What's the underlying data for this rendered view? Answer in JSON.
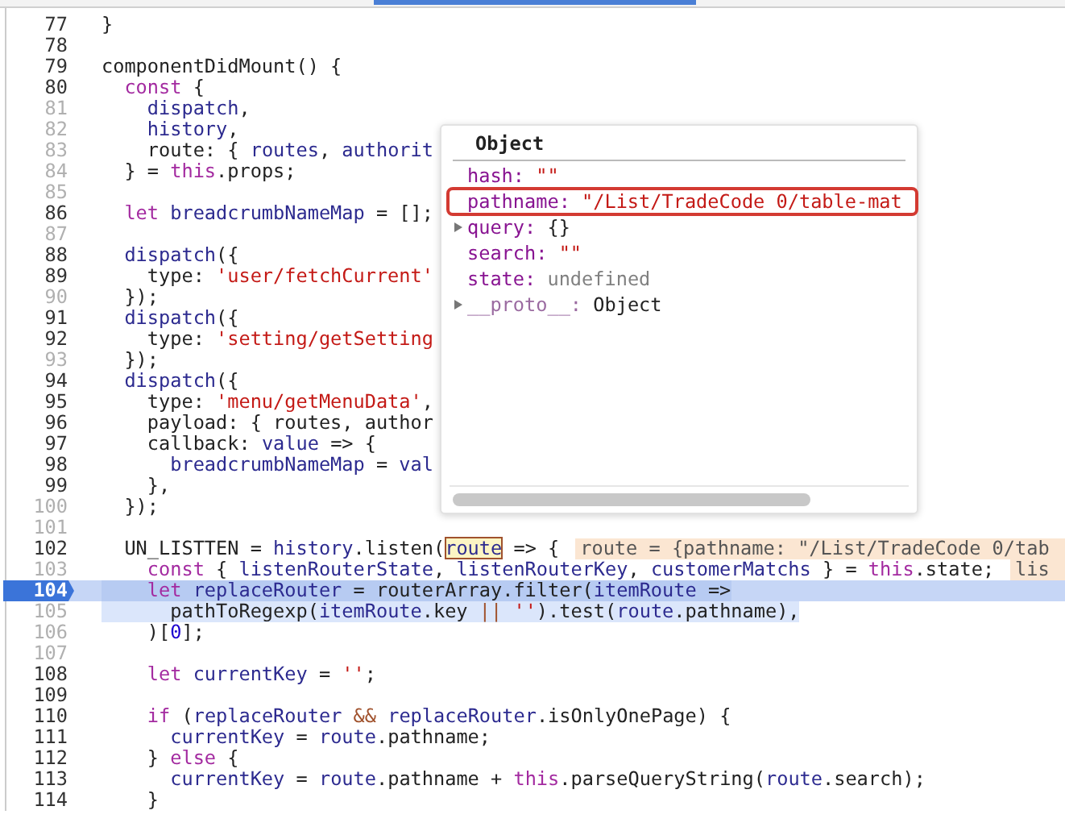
{
  "lines": [
    {
      "number": "77",
      "executable": true,
      "paused": false,
      "stepped": false,
      "tokens": [
        {
          "kind": "plain",
          "text": "}"
        }
      ]
    },
    {
      "number": "78",
      "executable": true,
      "paused": false,
      "stepped": false
    },
    {
      "number": "79",
      "executable": true,
      "paused": false,
      "stepped": false,
      "tokens": [
        {
          "kind": "plain",
          "text": "componentDidMount() {"
        }
      ]
    },
    {
      "number": "80",
      "executable": true,
      "paused": false,
      "stepped": false,
      "tokens": [
        {
          "kind": "kw",
          "text": "  const"
        },
        {
          "kind": "plain",
          "text": " {"
        }
      ]
    },
    {
      "number": "81",
      "executable": false,
      "paused": false,
      "stepped": false,
      "tokens": [
        {
          "kind": "var",
          "text": "    dispatch"
        },
        {
          "kind": "plain",
          "text": ","
        }
      ]
    },
    {
      "number": "82",
      "executable": false,
      "paused": false,
      "stepped": false,
      "tokens": [
        {
          "kind": "var",
          "text": "    history"
        },
        {
          "kind": "plain",
          "text": ","
        }
      ]
    },
    {
      "number": "83",
      "executable": false,
      "paused": false,
      "stepped": false,
      "tokens": [
        {
          "kind": "plain",
          "text": "    route: {"
        },
        {
          "kind": "var",
          "text": " routes"
        },
        {
          "kind": "plain",
          "text": ","
        },
        {
          "kind": "var",
          "text": " authorit"
        }
      ]
    },
    {
      "number": "84",
      "executable": false,
      "paused": false,
      "stepped": false,
      "tokens": [
        {
          "kind": "plain",
          "text": "  } ="
        },
        {
          "kind": "kw",
          "text": " this"
        },
        {
          "kind": "plain",
          "text": ".props;"
        }
      ]
    },
    {
      "number": "85",
      "executable": false,
      "paused": false,
      "stepped": false
    },
    {
      "number": "86",
      "executable": true,
      "paused": false,
      "stepped": false,
      "tokens": [
        {
          "kind": "kw",
          "text": "  let"
        },
        {
          "kind": "var",
          "text": " breadcrumbNameMap"
        },
        {
          "kind": "plain",
          "text": " = [];"
        }
      ]
    },
    {
      "number": "87",
      "executable": false,
      "paused": false,
      "stepped": false
    },
    {
      "number": "88",
      "executable": true,
      "paused": false,
      "stepped": false,
      "tokens": [
        {
          "kind": "var",
          "text": "  dispatch"
        },
        {
          "kind": "plain",
          "text": "({"
        }
      ]
    },
    {
      "number": "89",
      "executable": true,
      "paused": false,
      "stepped": false,
      "tokens": [
        {
          "kind": "plain",
          "text": "    type:"
        },
        {
          "kind": "str",
          "text": " 'user/fetchCurrent'"
        }
      ]
    },
    {
      "number": "90",
      "executable": false,
      "paused": false,
      "stepped": false,
      "tokens": [
        {
          "kind": "plain",
          "text": "  });"
        }
      ]
    },
    {
      "number": "91",
      "executable": true,
      "paused": false,
      "stepped": false,
      "tokens": [
        {
          "kind": "var",
          "text": "  dispatch"
        },
        {
          "kind": "plain",
          "text": "({"
        }
      ]
    },
    {
      "number": "92",
      "executable": true,
      "paused": false,
      "stepped": false,
      "tokens": [
        {
          "kind": "plain",
          "text": "    type:"
        },
        {
          "kind": "str",
          "text": " 'setting/getSetting"
        }
      ]
    },
    {
      "number": "93",
      "executable": false,
      "paused": false,
      "stepped": false,
      "tokens": [
        {
          "kind": "plain",
          "text": "  });"
        }
      ]
    },
    {
      "number": "94",
      "executable": true,
      "paused": false,
      "stepped": false,
      "tokens": [
        {
          "kind": "var",
          "text": "  dispatch"
        },
        {
          "kind": "plain",
          "text": "({"
        }
      ]
    },
    {
      "number": "95",
      "executable": true,
      "paused": false,
      "stepped": false,
      "tokens": [
        {
          "kind": "plain",
          "text": "    type:"
        },
        {
          "kind": "str",
          "text": " 'menu/getMenuData'"
        },
        {
          "kind": "plain",
          "text": ","
        }
      ]
    },
    {
      "number": "96",
      "executable": true,
      "paused": false,
      "stepped": false,
      "tokens": [
        {
          "kind": "plain",
          "text": "    payload: { routes, author"
        }
      ]
    },
    {
      "number": "97",
      "executable": true,
      "paused": false,
      "stepped": false,
      "tokens": [
        {
          "kind": "plain",
          "text": "    callback:"
        },
        {
          "kind": "var",
          "text": " value"
        },
        {
          "kind": "plain",
          "text": " => {"
        }
      ]
    },
    {
      "number": "98",
      "executable": true,
      "paused": false,
      "stepped": false,
      "tokens": [
        {
          "kind": "var",
          "text": "      breadcrumbNameMap"
        },
        {
          "kind": "plain",
          "text": " ="
        },
        {
          "kind": "var",
          "text": " val"
        }
      ]
    },
    {
      "number": "99",
      "executable": true,
      "paused": false,
      "stepped": false,
      "tokens": [
        {
          "kind": "plain",
          "text": "    },"
        }
      ]
    },
    {
      "number": "100",
      "executable": false,
      "paused": false,
      "stepped": false,
      "tokens": [
        {
          "kind": "plain",
          "text": "  });"
        }
      ]
    },
    {
      "number": "101",
      "executable": false,
      "paused": false,
      "stepped": false
    },
    {
      "number": "102",
      "executable": true,
      "paused": false,
      "stepped": false,
      "tokens": [
        {
          "kind": "plain",
          "text": "  UN_LISTTEN ="
        },
        {
          "kind": "var",
          "text": " history"
        },
        {
          "kind": "plain",
          "text": ".listen("
        },
        {
          "kind": "var",
          "text": "route",
          "hovered": true
        },
        {
          "kind": "plain",
          "text": " => {"
        }
      ],
      "inline_value": "route = {pathname: \"/List/TradeCode 0/tab"
    },
    {
      "number": "103",
      "executable": false,
      "paused": false,
      "stepped": false,
      "tokens": [
        {
          "kind": "kw",
          "text": "    const"
        },
        {
          "kind": "plain",
          "text": " {"
        },
        {
          "kind": "var",
          "text": " listenRouterState"
        },
        {
          "kind": "plain",
          "text": ","
        },
        {
          "kind": "var",
          "text": " listenRouterKey"
        },
        {
          "kind": "plain",
          "text": ","
        },
        {
          "kind": "var",
          "text": " customerMatchs"
        },
        {
          "kind": "plain",
          "text": " } ="
        },
        {
          "kind": "kw",
          "text": " this"
        },
        {
          "kind": "plain",
          "text": ".state;"
        }
      ],
      "inline_value": "lis"
    },
    {
      "number": "104",
      "executable": true,
      "paused": true,
      "stepped": true,
      "tokens": [
        {
          "kind": "kw",
          "text": "    let"
        },
        {
          "kind": "var",
          "text": " replaceRouter"
        },
        {
          "kind": "plain",
          "text": " = routerArray.filter("
        },
        {
          "kind": "var",
          "text": "itemRoute"
        },
        {
          "kind": "plain",
          "text": " =>"
        }
      ]
    },
    {
      "number": "105",
      "executable": false,
      "paused": false,
      "stepped": true,
      "tokens": [
        {
          "kind": "plain",
          "text": "      pathToRegexp("
        },
        {
          "kind": "var",
          "text": "itemRoute"
        },
        {
          "kind": "plain",
          "text": ".key"
        },
        {
          "kind": "op",
          "text": " ||"
        },
        {
          "kind": "str",
          "text": " ''"
        },
        {
          "kind": "plain",
          "text": ").test("
        },
        {
          "kind": "var",
          "text": "route"
        },
        {
          "kind": "plain",
          "text": ".pathname),"
        }
      ]
    },
    {
      "number": "106",
      "executable": false,
      "paused": false,
      "stepped": false,
      "tokens": [
        {
          "kind": "plain",
          "text": "    )["
        },
        {
          "kind": "num",
          "text": "0"
        },
        {
          "kind": "plain",
          "text": "];"
        }
      ]
    },
    {
      "number": "107",
      "executable": false,
      "paused": false,
      "stepped": false
    },
    {
      "number": "108",
      "executable": true,
      "paused": false,
      "stepped": false,
      "tokens": [
        {
          "kind": "kw",
          "text": "    let"
        },
        {
          "kind": "var",
          "text": " currentKey"
        },
        {
          "kind": "plain",
          "text": " ="
        },
        {
          "kind": "str",
          "text": " ''"
        },
        {
          "kind": "plain",
          "text": ";"
        }
      ]
    },
    {
      "number": "109",
      "executable": true,
      "paused": false,
      "stepped": false
    },
    {
      "number": "110",
      "executable": true,
      "paused": false,
      "stepped": false,
      "tokens": [
        {
          "kind": "kw",
          "text": "    if"
        },
        {
          "kind": "plain",
          "text": " ("
        },
        {
          "kind": "var",
          "text": "replaceRouter"
        },
        {
          "kind": "op",
          "text": " &&"
        },
        {
          "kind": "var",
          "text": " replaceRouter"
        },
        {
          "kind": "plain",
          "text": ".isOnlyOnePage) {"
        }
      ]
    },
    {
      "number": "111",
      "executable": true,
      "paused": false,
      "stepped": false,
      "tokens": [
        {
          "kind": "var",
          "text": "      currentKey"
        },
        {
          "kind": "plain",
          "text": " ="
        },
        {
          "kind": "var",
          "text": " route"
        },
        {
          "kind": "plain",
          "text": ".pathname;"
        }
      ]
    },
    {
      "number": "112",
      "executable": true,
      "paused": false,
      "stepped": false,
      "tokens": [
        {
          "kind": "plain",
          "text": "    }"
        },
        {
          "kind": "kw",
          "text": " else"
        },
        {
          "kind": "plain",
          "text": " {"
        }
      ]
    },
    {
      "number": "113",
      "executable": true,
      "paused": false,
      "stepped": false,
      "tokens": [
        {
          "kind": "var",
          "text": "      currentKey"
        },
        {
          "kind": "plain",
          "text": " ="
        },
        {
          "kind": "var",
          "text": " route"
        },
        {
          "kind": "plain",
          "text": ".pathname +"
        },
        {
          "kind": "kw",
          "text": " this"
        },
        {
          "kind": "plain",
          "text": ".parseQueryString("
        },
        {
          "kind": "var",
          "text": "route"
        },
        {
          "kind": "plain",
          "text": ".search);"
        }
      ]
    },
    {
      "number": "114",
      "executable": true,
      "paused": false,
      "stepped": false,
      "tokens": [
        {
          "kind": "plain",
          "text": "    }"
        }
      ]
    }
  ],
  "popover": {
    "title": "Object",
    "properties": [
      {
        "name": "hash:",
        "value": "\"\"",
        "kind": "string",
        "expandable": false,
        "highlighted": false
      },
      {
        "name": "pathname:",
        "value": "\"/List/TradeCode 0/table-mat",
        "kind": "string",
        "expandable": false,
        "highlighted": true
      },
      {
        "name": "query:",
        "value": "{}",
        "kind": "object",
        "expandable": true,
        "highlighted": false
      },
      {
        "name": "search:",
        "value": "\"\"",
        "kind": "string",
        "expandable": false,
        "highlighted": false
      },
      {
        "name": "state:",
        "value": "undefined",
        "kind": "undefined",
        "expandable": false,
        "highlighted": false
      },
      {
        "name": "__proto__:",
        "value": "Object",
        "kind": "object",
        "expandable": true,
        "highlighted": false
      }
    ]
  }
}
